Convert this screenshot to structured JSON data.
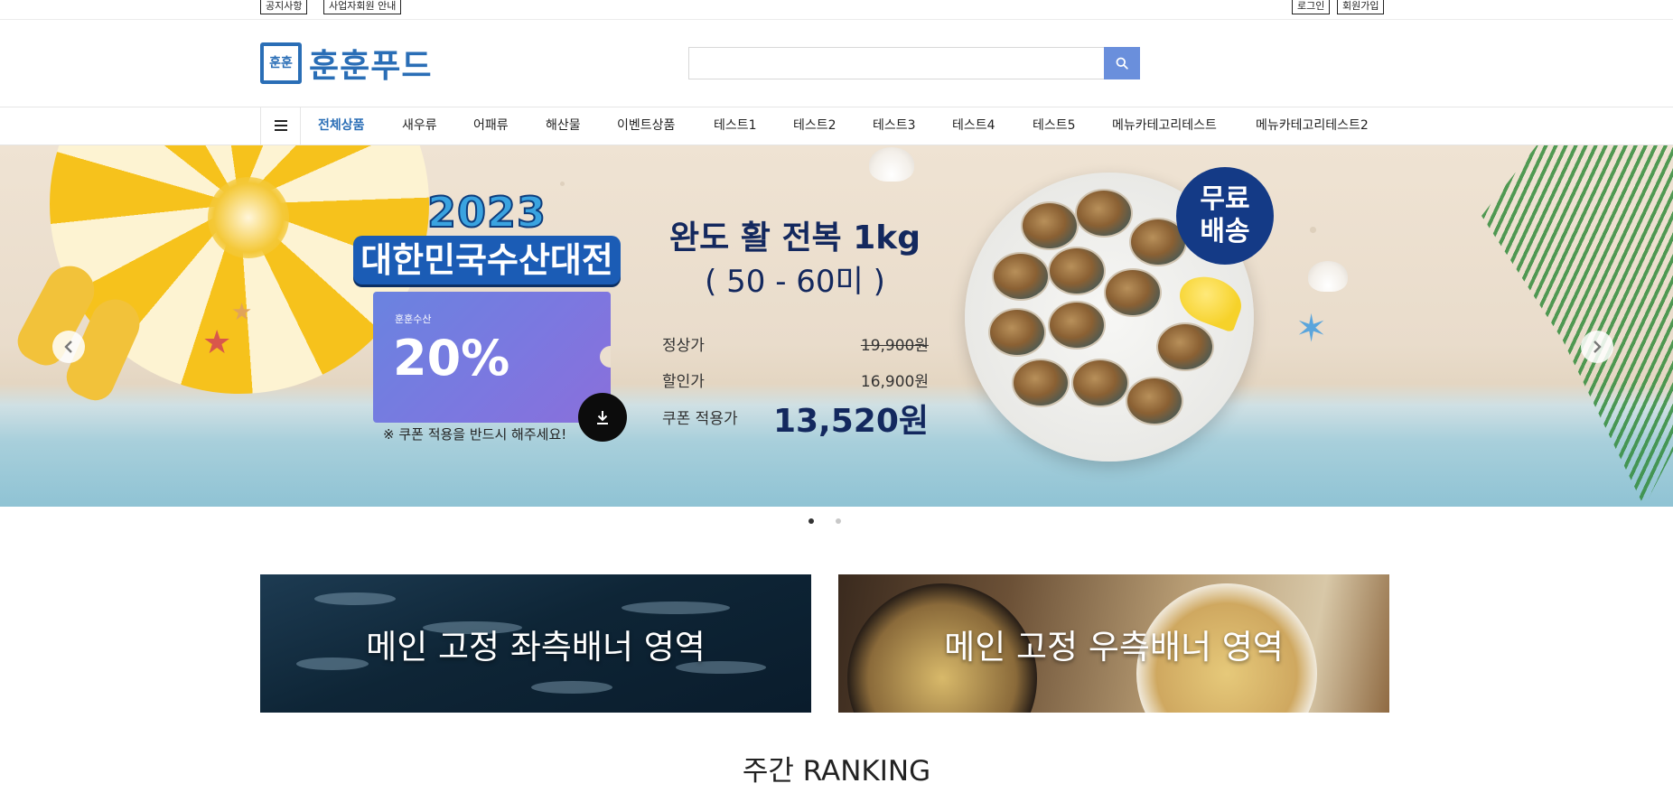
{
  "topbar": {
    "left": [
      "공지사항",
      "사업자회원 안내"
    ],
    "right": [
      "로그인",
      "회원가입"
    ]
  },
  "header": {
    "logo_mark": "훈훈",
    "logo_text": "훈훈푸드",
    "search": {
      "value": "",
      "placeholder": ""
    },
    "search_icon": "search-icon"
  },
  "nav": {
    "menu_icon": "hamburger-icon",
    "items": [
      "전체상품",
      "새우류",
      "어패류",
      "해산물",
      "이벤트상품",
      "테스트1",
      "테스트2",
      "테스트3",
      "테스트4",
      "테스트5",
      "메뉴카테고리테스트",
      "메뉴카테고리테스트2"
    ],
    "active_index": 0
  },
  "hero": {
    "event_year": "2023",
    "event_title": "대한민국수산대전",
    "coupon_brand": "훈훈수산",
    "coupon_percent": "20%",
    "coupon_note": "※ 쿠폰 적용을 반드시 해주세요!",
    "product_name": "완도 활 전복 1kg",
    "product_count": "( 50 - 60미 )",
    "regular_label": "정상가",
    "regular_price": "19,900원",
    "sale_label": "할인가",
    "sale_price": "16,900원",
    "coupon_label": "쿠폰 적용가",
    "coupon_price": "13,520원",
    "free_shipping_line1": "무료",
    "free_shipping_line2": "배송",
    "slide_count": 2,
    "active_slide": 0
  },
  "banners": {
    "left": "메인 고정 좌측배너 영역",
    "right": "메인 고정 우측배너 영역"
  },
  "ranking_title": "주간 RANKING",
  "colors": {
    "brand": "#2a6eb6",
    "search_button": "#6a8fdc",
    "navy": "#13285e",
    "badge": "#143a86"
  }
}
